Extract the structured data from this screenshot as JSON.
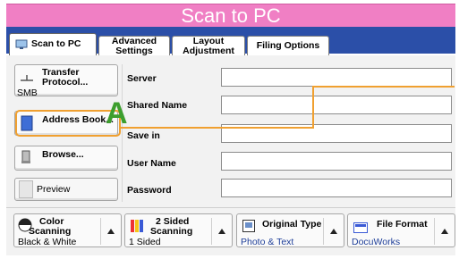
{
  "title": "Scan to PC",
  "tabs": [
    {
      "label": "Scan to PC"
    },
    {
      "line1": "Advanced",
      "line2": "Settings"
    },
    {
      "line1": "Layout",
      "line2": "Adjustment"
    },
    {
      "label": "Filing Options"
    }
  ],
  "transfer_protocol": {
    "label_line1": "Transfer",
    "label_line2": "Protocol...",
    "value": "SMB"
  },
  "address_book": {
    "label": "Address Book..."
  },
  "browse": {
    "label": "Browse..."
  },
  "preview": {
    "label": "Preview"
  },
  "fields": [
    {
      "label": "Server",
      "value": ""
    },
    {
      "label": "Shared Name",
      "value": ""
    },
    {
      "label": "Save in",
      "value": ""
    },
    {
      "label": "User Name",
      "value": ""
    },
    {
      "label": "Password",
      "value": ""
    }
  ],
  "features": [
    {
      "title_line1": "Color",
      "title_line2": "Scanning",
      "value": "Black & White"
    },
    {
      "title_line1": "2 Sided",
      "title_line2": "Scanning",
      "value": "1 Sided"
    },
    {
      "title_line1": "Original Type",
      "title_line2": "",
      "value": "Photo & Text"
    },
    {
      "title_line1": "File Format",
      "title_line2": "",
      "value": "DocuWorks"
    }
  ],
  "annotation": {
    "letter": "A",
    "color": "#3d9e2e",
    "highlight_color": "#f0a030"
  },
  "colors": {
    "title_bg": "#f07fc4",
    "tab_strip": "#2b4fa8",
    "panel_bg": "#f2f2f2"
  }
}
